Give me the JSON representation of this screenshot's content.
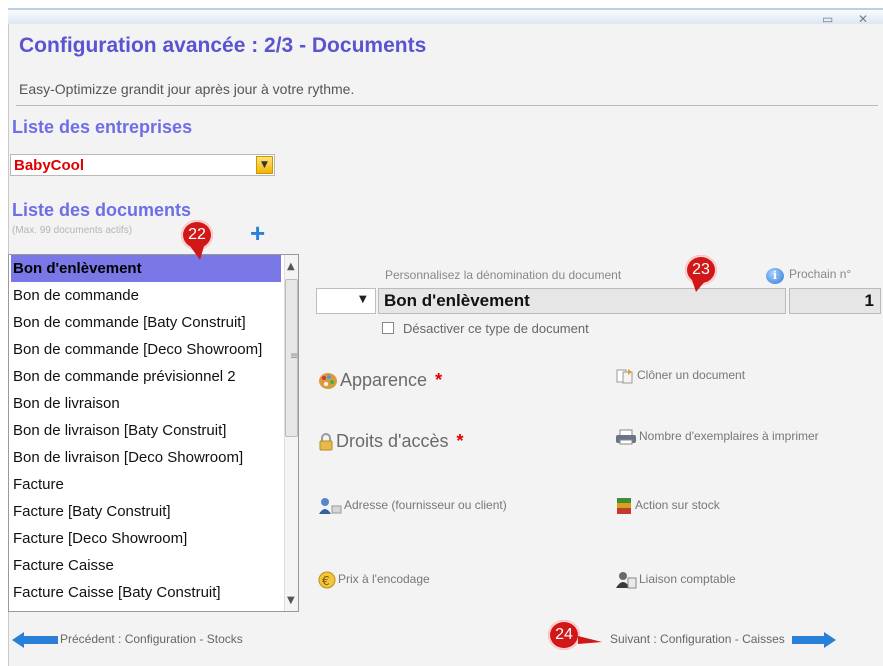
{
  "window": {
    "title": "Configuration avancée : 2/3  -  Documents",
    "subtitle": "Easy-Optimizze grandit jour après jour à votre rythme.",
    "minimize_glyph": "▭",
    "close_glyph": "✕"
  },
  "companies": {
    "heading": "Liste des entreprises",
    "selected": "BabyCool"
  },
  "documents": {
    "heading": "Liste des documents",
    "max_note": "(Max. 99 documents actifs)",
    "add_glyph": "+",
    "items": [
      "Bon d'enlèvement",
      "Bon de commande",
      "Bon de commande [Baty Construit]",
      "Bon de commande [Deco Showroom]",
      "Bon de commande prévisionnel 2",
      "Bon de livraison",
      "Bon de livraison [Baty Construit]",
      "Bon de livraison [Deco Showroom]",
      "Facture",
      "Facture [Baty Construit]",
      "Facture [Deco Showroom]",
      "Facture Caisse",
      "Facture Caisse [Baty Construit]"
    ]
  },
  "detail": {
    "name_caption": "Personnalisez la dénomination du document",
    "next_caption": "Prochain n°",
    "doc_name": "Bon d'enlèvement",
    "next_number": "1",
    "deactivate_label": "Désactiver ce type de document"
  },
  "options": {
    "appearance": "Apparence",
    "access_rights": "Droits d'accès",
    "required_mark": "*",
    "clone": "Clôner un document",
    "print_copies": "Nombre d'exemplaires à imprimer",
    "address": "Adresse (fournisseur ou client)",
    "stock_action": "Action sur stock",
    "price_encoding": "Prix à l'encodage",
    "accounting_link": "Liaison comptable"
  },
  "navigation": {
    "previous": "Précédent : Configuration - Stocks",
    "next": "Suivant : Configuration - Caisses"
  },
  "badges": {
    "b22": "22",
    "b23": "23",
    "b24": "24"
  },
  "colors": {
    "title": "#5a54d0",
    "heading": "#6e6ee6",
    "selection": "#7a78e6",
    "required": "#e00000",
    "badge": "#d01818",
    "nav_arrow": "#2a7fd6"
  }
}
